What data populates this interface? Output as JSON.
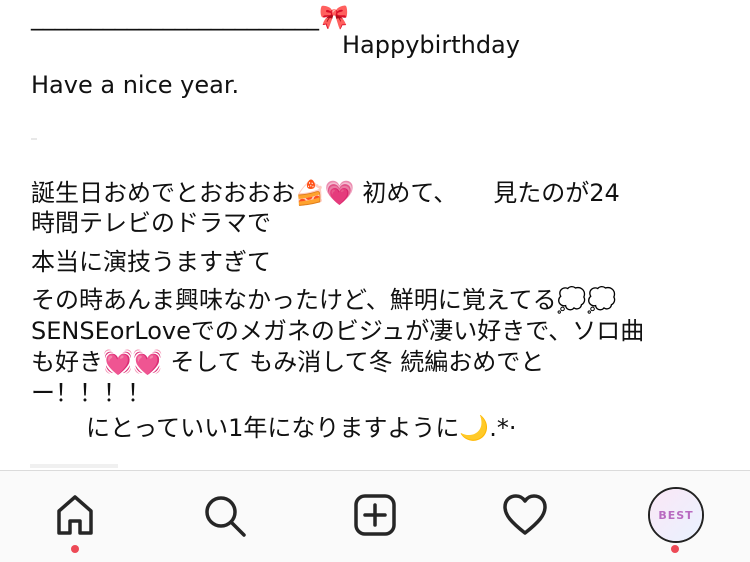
{
  "caption": {
    "header_rule": "________________________",
    "header_emoji": "🎀",
    "title": "Happybirthday",
    "greeting": "Have a nice year.",
    "lines": [
      "誕生日おめでとおおおお🍰💗 初めて、　　見たのが24",
      "時間テレビのドラマで",
      "本当に演技うますぎて",
      "その時あんま興味なかったけど、鮮明に覚えてる💭💭",
      "SENSEorLoveでのメガネのビジュが凄い好きで、ソロ曲",
      "も好き💓💓 そして もみ消して冬 続編おめでと",
      "ー！！！！",
      "にとっていい1年になりますように🌙.*·"
    ]
  },
  "tabbar": {
    "tabs": [
      {
        "name": "home",
        "icon": "home-icon",
        "notification": true
      },
      {
        "name": "search",
        "icon": "search-icon",
        "notification": false
      },
      {
        "name": "new-post",
        "icon": "plus-square-icon",
        "notification": false
      },
      {
        "name": "activity",
        "icon": "heart-icon",
        "notification": false
      },
      {
        "name": "profile",
        "icon": "avatar",
        "notification": true,
        "avatar_text": "BEST"
      }
    ],
    "notification_color": "#ed4956"
  }
}
